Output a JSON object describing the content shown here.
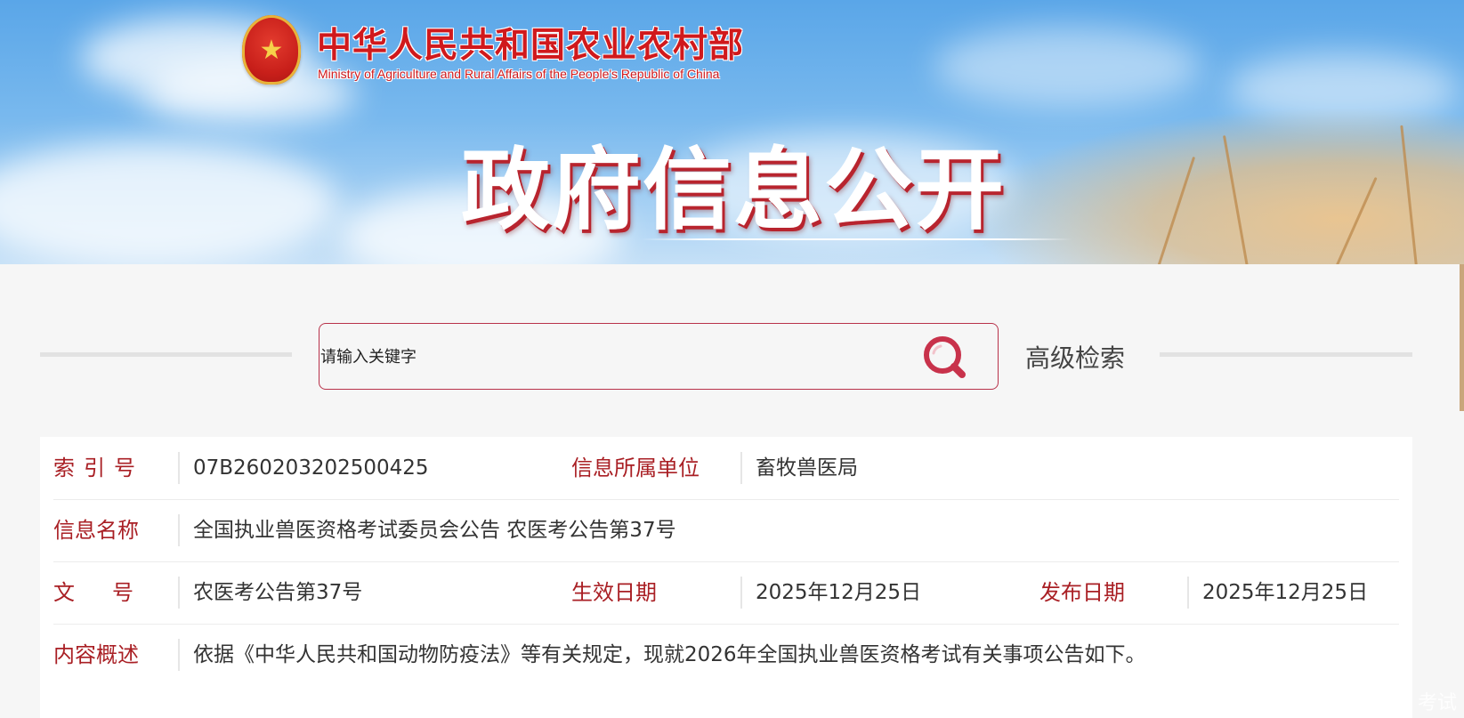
{
  "header": {
    "ministry_cn": "中华人民共和国农业农村部",
    "ministry_en": "Ministry of Agriculture  and  Rural  Affairs  of the People's Republic of China",
    "banner_title": "政府信息公开",
    "emblem_icon": "national-emblem-icon"
  },
  "search": {
    "placeholder": "请输入关键字",
    "search_icon": "search-icon",
    "advanced_label": "高级检索"
  },
  "info": {
    "index_label": "索引号",
    "index_value": "07B260203202500425",
    "unit_label": "信息所属单位",
    "unit_value": "畜牧兽医局",
    "name_label": "信息名称",
    "name_value": "全国执业兽医资格考试委员会公告 农医考公告第37号",
    "doc_label": "文号",
    "doc_value": "农医考公告第37号",
    "effective_label": "生效日期",
    "effective_value": "2025年12月25日",
    "publish_label": "发布日期",
    "publish_value": "2025年12月25日",
    "summary_label": "内容概述",
    "summary_value": "依据《中华人民共和国动物防疫法》等有关规定，现就2026年全国执业兽医资格考试有关事项公告如下。"
  },
  "watermark": "考试",
  "colors": {
    "brand_red": "#d0191c",
    "label_red": "#a91f24",
    "search_border": "#b8324a"
  }
}
